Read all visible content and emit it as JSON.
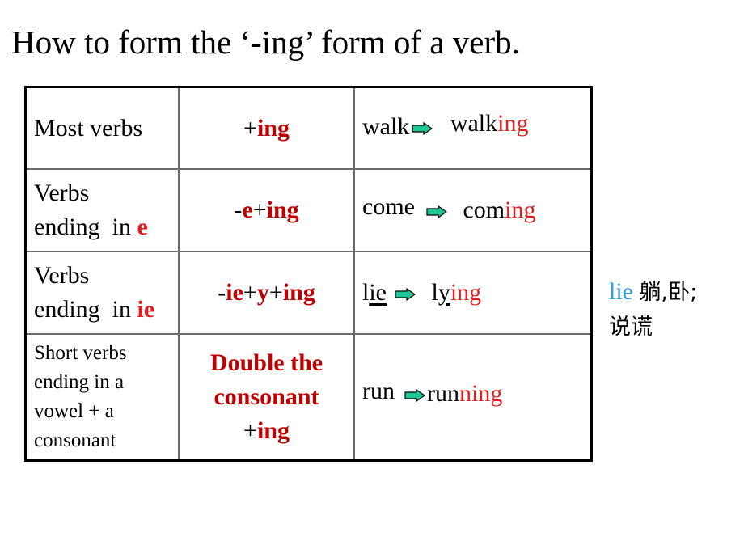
{
  "title": "How to form the ‘-ing’ form of a verb.",
  "table": {
    "rows": [
      {
        "category": {
          "line1": "Most verbs",
          "line2": "",
          "highlight": ""
        },
        "rule": {
          "parts": [
            "+",
            "ing"
          ]
        },
        "example": {
          "base": "walk",
          "result_stem": "walk",
          "result_suffix": "ing"
        }
      },
      {
        "category": {
          "line1": "Verbs",
          "line2": "ending  in ",
          "highlight": "e"
        },
        "rule": {
          "parts": [
            "-",
            "e",
            "+",
            "ing"
          ]
        },
        "example": {
          "base": "come",
          "result_stem": "com",
          "result_suffix": "ing"
        }
      },
      {
        "category": {
          "line1": "Verbs",
          "line2": "ending  in ",
          "highlight": "ie"
        },
        "rule": {
          "parts": [
            "-",
            "ie",
            "+",
            "y",
            "+",
            "ing"
          ]
        },
        "example": {
          "base_plain": "l",
          "base_underlined": "ie",
          "result_plain": "l",
          "result_underlined": "y",
          "result_suffix": "ing"
        }
      },
      {
        "category": {
          "lines": [
            "Short verbs",
            "ending in a",
            "vowel + a",
            "consonant"
          ]
        },
        "rule": {
          "line1": "Double the",
          "line2": "consonant",
          "line3_plus": "+",
          "line3_ing": "ing"
        },
        "example": {
          "base": "run",
          "result_stem": "run",
          "result_suffix": "ning"
        }
      }
    ]
  },
  "icons": {
    "arrow": "right-arrow-icon",
    "arrow_fill": "#1fc497",
    "arrow_stroke": "#000000"
  },
  "note": {
    "word": "lie",
    "meaning1": "躺,卧;",
    "meaning2": "说谎"
  },
  "colors": {
    "rule_red": "#c00000",
    "suffix_red": "#e02020",
    "note_blue": "#2f9be0"
  }
}
